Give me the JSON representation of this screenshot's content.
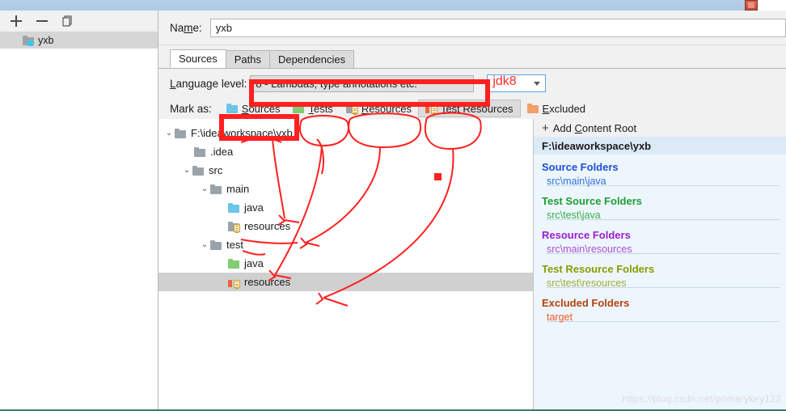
{
  "window": {
    "close_label": "×"
  },
  "left_panel": {
    "toolbar": [
      {
        "name": "add",
        "glyph": "+"
      },
      {
        "name": "remove",
        "glyph": "−"
      },
      {
        "name": "copy",
        "glyph": "copy-icon"
      }
    ],
    "modules": [
      {
        "label": "yxb",
        "icon": "module-folder-icon",
        "selected": true
      }
    ]
  },
  "name_field": {
    "label_pre": "Na",
    "label_mid": "m",
    "label_post": "e:",
    "value": "yxb"
  },
  "tabs": [
    {
      "label": "Sources",
      "active": true
    },
    {
      "label": "Paths",
      "active": false
    },
    {
      "label": "Dependencies",
      "active": false
    }
  ],
  "language_level": {
    "label_pre": "L",
    "label_post": "anguage level:",
    "value": "8 - Lambdas, type annotations etc.",
    "annotation_text": "jdk8"
  },
  "mark_as": {
    "label": "Mark as:",
    "buttons": [
      {
        "label_pre": "S",
        "label_post": "ources",
        "icon": "folder-blue-icon",
        "pressed": true
      },
      {
        "label_pre": "T",
        "label_post": "ests",
        "icon": "folder-green-icon",
        "pressed": false
      },
      {
        "label_pre": "R",
        "label_post": "esources",
        "icon": "folder-resources-icon",
        "pressed": false
      },
      {
        "label_pre": "T",
        "label_post": "est Resources",
        "icon": "folder-test-resources-icon",
        "pressed": true
      },
      {
        "label_pre": "E",
        "label_post": "xcluded",
        "icon": "folder-orange-icon",
        "pressed": false
      }
    ]
  },
  "tree": [
    {
      "label": "F:\\ideaworkspace\\yxb",
      "indent": 0,
      "arrow": "expanded",
      "icon": "folder-gray-icon",
      "selected": false
    },
    {
      "label": ".idea",
      "indent": 1,
      "arrow": "none",
      "icon": "folder-gray-icon",
      "selected": false
    },
    {
      "label": "src",
      "indent": 1,
      "arrow": "expanded",
      "icon": "folder-gray-icon",
      "selected": false
    },
    {
      "label": "main",
      "indent": 2,
      "arrow": "expanded",
      "icon": "folder-gray-icon",
      "selected": false
    },
    {
      "label": "java",
      "indent": 3,
      "arrow": "none",
      "icon": "folder-blue-icon",
      "selected": false
    },
    {
      "label": "resources",
      "indent": 3,
      "arrow": "none",
      "icon": "folder-resources-icon",
      "selected": false
    },
    {
      "label": "test",
      "indent": 2,
      "arrow": "expanded",
      "icon": "folder-gray-icon",
      "selected": false
    },
    {
      "label": "java",
      "indent": 3,
      "arrow": "none",
      "icon": "folder-green-icon",
      "selected": false
    },
    {
      "label": "resources",
      "indent": 3,
      "arrow": "none",
      "icon": "folder-test-resources-icon",
      "selected": true
    }
  ],
  "detail": {
    "add_content_root": {
      "plus": "+",
      "label_pre": "Add ",
      "label_mid": "C",
      "label_post": "ontent Root"
    },
    "content_root": "F:\\ideaworkspace\\yxb",
    "groups": [
      {
        "title": "Source Folders",
        "color": "#1f4fd8",
        "items": [
          "src\\main\\java"
        ]
      },
      {
        "title": "Test Source Folders",
        "color": "#1d9e33",
        "items": [
          "src\\test\\java"
        ]
      },
      {
        "title": "Resource Folders",
        "color": "#9b1fcf",
        "items": [
          "src\\main\\resources"
        ]
      },
      {
        "title": "Test Resource Folders",
        "color": "#8a9b00",
        "items": [
          "src\\test\\resources"
        ]
      },
      {
        "title": "Excluded Folders",
        "color": "#b3430e",
        "items": [
          "target"
        ]
      }
    ]
  },
  "watermark": "https://blog.csdn.net/primarykey123",
  "annotations": {
    "color": "#ff2020",
    "box_label": "language-level-highlight-box",
    "square_marker": "red-square-marker",
    "ellipses": [
      "tests-circle",
      "resources-circle",
      "test-resources-circle"
    ],
    "arrows": [
      "sources-to-main-java",
      "tests-to-test-java",
      "resources-to-main-resources",
      "test-resources-to-test-resources"
    ]
  }
}
